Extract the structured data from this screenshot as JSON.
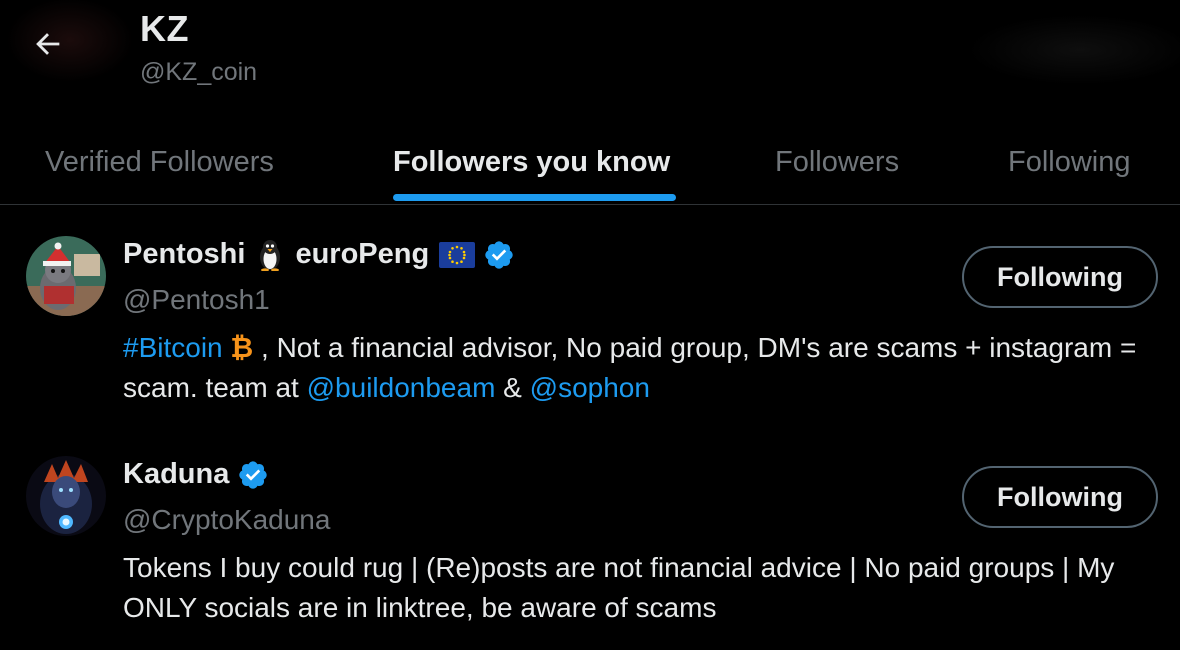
{
  "header": {
    "title": "KZ",
    "handle": "@KZ_coin"
  },
  "tabs": [
    {
      "label": "Verified Followers",
      "active": false
    },
    {
      "label": "Followers you know",
      "active": true
    },
    {
      "label": "Followers",
      "active": false
    },
    {
      "label": "Following",
      "active": false
    }
  ],
  "accent_color": "#1d9bf0",
  "users": [
    {
      "name_part1": "Pentoshi",
      "name_emoji1": "penguin-icon",
      "name_part2": "euroPeng",
      "name_emoji2": "eu-flag-icon",
      "verified": true,
      "handle": "@Pentosh1",
      "bio": {
        "hashtag": "#Bitcoin",
        "bitcoin_emoji": "₿",
        "text1": " , Not a financial advisor, No paid group, DM's are scams + instagram = scam. team at ",
        "mention1": "@buildonbeam",
        "text2": " & ",
        "mention2": "@sophon"
      },
      "button_label": "Following"
    },
    {
      "name": "Kaduna",
      "verified": true,
      "handle": "@CryptoKaduna",
      "bio": "Tokens I buy could rug | (Re)posts are not financial advice | No paid groups | My ONLY socials are in linktree, be aware of scams",
      "button_label": "Following"
    }
  ]
}
